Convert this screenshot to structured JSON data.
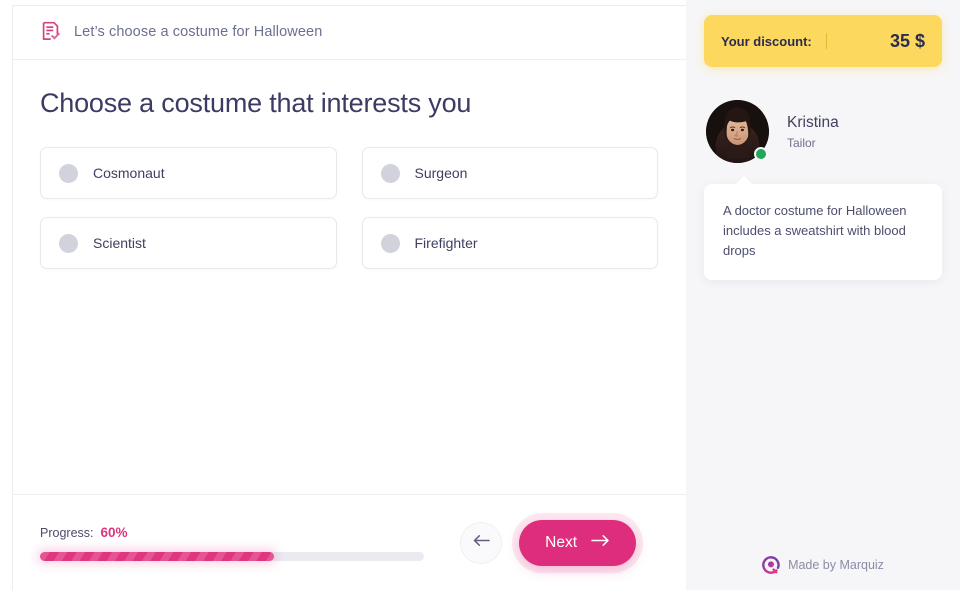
{
  "quiz": {
    "header": {
      "icon": "form-check-icon",
      "title": "Let’s choose a costume for Halloween"
    },
    "question": {
      "title": "Choose a costume that interests you",
      "options": [
        {
          "label": "Cosmonaut"
        },
        {
          "label": "Surgeon"
        },
        {
          "label": "Scientist"
        },
        {
          "label": "Firefighter"
        }
      ]
    },
    "footer": {
      "progress_caption": "Progress:",
      "progress_value": "60%",
      "progress_percent": 61,
      "back_icon": "arrow-left-icon",
      "next_label": "Next",
      "next_icon": "arrow-right-icon"
    }
  },
  "sidebar": {
    "discount": {
      "label": "Your discount:",
      "amount": "35 $"
    },
    "profile": {
      "avatar": "avatar-photo",
      "status": "online",
      "name": "Kristina",
      "role": "Tailor"
    },
    "message": {
      "text": "A doctor costume for Halloween includes a sweatshirt with blood drops"
    },
    "branding": {
      "logo": "marquiz-logo-icon",
      "text": "Made by Marquiz"
    }
  },
  "colors": {
    "accent_pink": "#de2d7d",
    "progress_pink": "#e0357f",
    "discount_yellow": "#fcd95e",
    "sidebar_bg": "#f6f6f8",
    "text_dark": "#3b3b63",
    "status_green": "#21a65a"
  }
}
